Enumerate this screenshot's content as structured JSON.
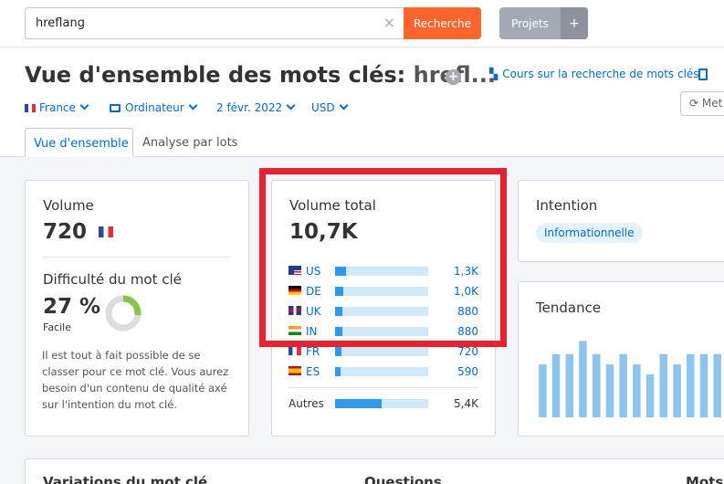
{
  "search": {
    "value": "hreflang",
    "clear_glyph": "×",
    "button": "Recherche"
  },
  "projects": {
    "label": "Projets",
    "plus": "+"
  },
  "header": {
    "title_prefix": "Vue d'ensemble des mots clés:",
    "title_keyword": "hrefl...",
    "course_link": "Cours sur la recherche de mots clés",
    "refresh_label": "Met"
  },
  "filters": {
    "country": "France",
    "device": "Ordinateur",
    "date": "2 févr. 2022",
    "currency": "USD"
  },
  "tabs": [
    "Vue d'ensemble",
    "Analyse par lots"
  ],
  "volume_card": {
    "title": "Volume",
    "value": "720",
    "difficulty_title": "Difficulté du mot clé",
    "difficulty_value": "27 %",
    "difficulty_percent": 27,
    "difficulty_label": "Facile",
    "description": "Il est tout à fait possible de se classer pour ce mot clé. Vous aurez besoin d'un contenu de qualité axé sur l'intention du mot clé."
  },
  "total_volume_card": {
    "title": "Volume total",
    "value": "10,7K",
    "countries": [
      {
        "code": "US",
        "value": "1,3K",
        "fill_percent": 12
      },
      {
        "code": "DE",
        "value": "1,0K",
        "fill_percent": 9
      },
      {
        "code": "UK",
        "value": "880",
        "fill_percent": 8
      },
      {
        "code": "IN",
        "value": "880",
        "fill_percent": 8
      },
      {
        "code": "FR",
        "value": "720",
        "fill_percent": 7
      },
      {
        "code": "ES",
        "value": "590",
        "fill_percent": 6
      }
    ],
    "others_label": "Autres",
    "others_value": "5,4K",
    "others_fill_percent": 50
  },
  "intent_card": {
    "title": "Intention",
    "badge": "Informationnelle"
  },
  "trend_card": {
    "title": "Tendance",
    "values": [
      52,
      62,
      62,
      75,
      62,
      52,
      62,
      52,
      42,
      62,
      52,
      62,
      62,
      62
    ]
  },
  "bottom": {
    "variations": "Variations du mot clé",
    "questions": "Questions",
    "mots": "Mots"
  },
  "colors": {
    "accent": "#006dca",
    "search_button": "#ff642d",
    "bar": "#2d9bed",
    "bar_bg": "#d1e8f9",
    "trend_bar": "#8ec5ee",
    "donut_fill": "#8bc34a",
    "donut_bg": "#dcdcdc",
    "highlight_frame": "#e8212e"
  }
}
